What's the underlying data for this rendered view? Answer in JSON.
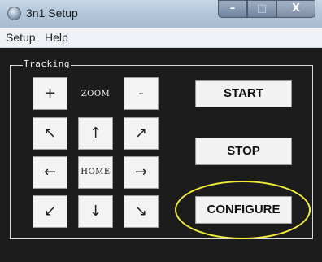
{
  "window": {
    "title": "3n1 Setup",
    "minimize": "–",
    "maximize": "□",
    "close": "X"
  },
  "menu": {
    "items": [
      "Setup",
      "Help"
    ]
  },
  "tracking": {
    "label": "Tracking",
    "zoom_in": "+",
    "zoom_label": "ZOOM",
    "zoom_out": "-",
    "up_left": "↖",
    "up": "↑",
    "up_right": "↗",
    "left": "←",
    "home": "HOME",
    "right": "→",
    "down_left": "↙",
    "down": "↓",
    "down_right": "↘"
  },
  "actions": {
    "start": "START",
    "stop": "STOP",
    "configure": "CONFIGURE"
  },
  "colors": {
    "highlight": "#f3eb3a",
    "background": "#1c1c1c"
  }
}
